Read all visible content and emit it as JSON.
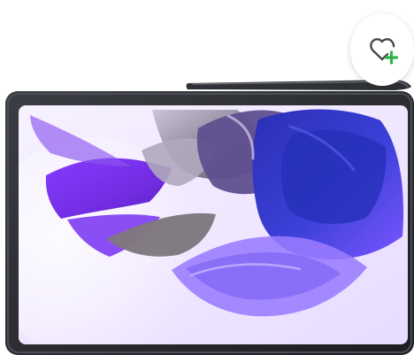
{
  "product": {
    "image_alt": "",
    "device": "tablet-with-stylus"
  },
  "wishlist": {
    "icon": "heart-plus-icon",
    "accent": "#2db34a"
  },
  "colors": {
    "bezel": "#2b2d31",
    "screen_light": "#f0e8fb",
    "fabric_purple": "#7b2cf1",
    "fabric_blue": "#4140df",
    "background": "#ffffff"
  }
}
